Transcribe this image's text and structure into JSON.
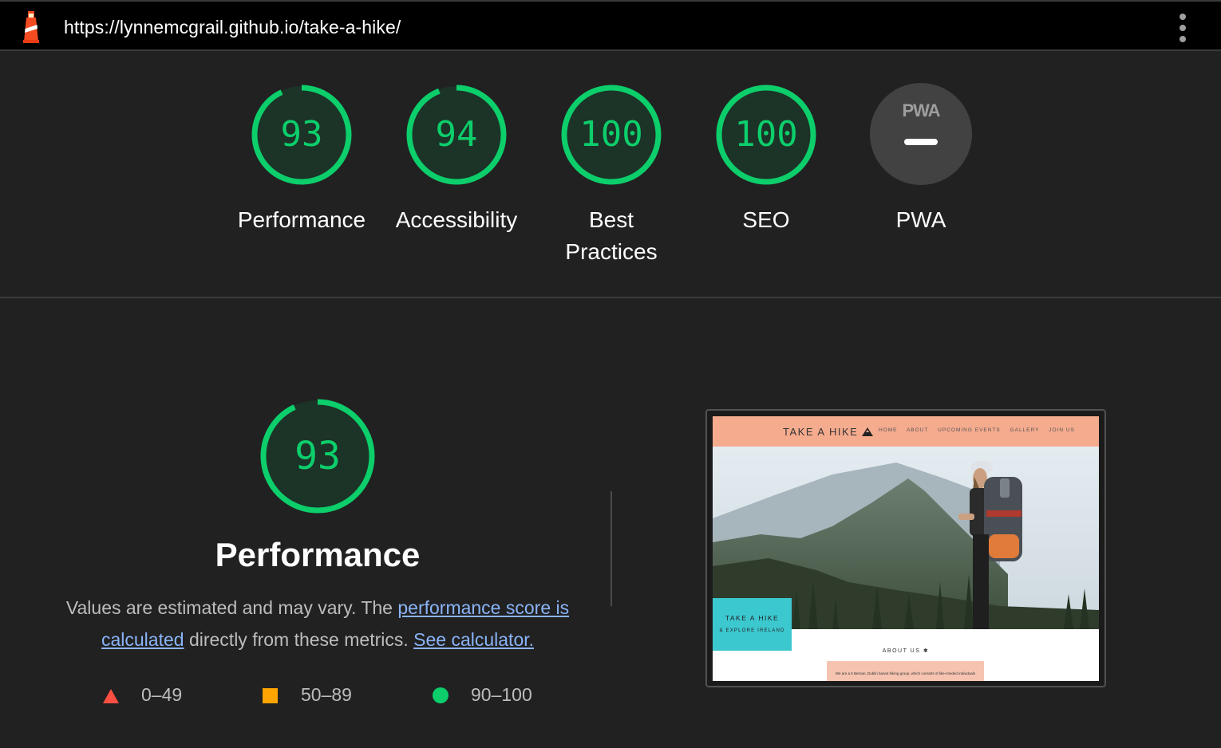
{
  "address_bar": {
    "url": "https://lynnemcgrail.github.io/take-a-hike/"
  },
  "categories": [
    {
      "id": "performance",
      "label": "Performance",
      "score": "93",
      "value": 93
    },
    {
      "id": "accessibility",
      "label": "Accessibility",
      "score": "94",
      "value": 94
    },
    {
      "id": "best-practices",
      "label": "Best Practices",
      "score": "100",
      "value": 100
    },
    {
      "id": "seo",
      "label": "SEO",
      "score": "100",
      "value": 100
    }
  ],
  "pwa": {
    "label": "PWA",
    "badge_text": "PWA"
  },
  "performance_section": {
    "score": "93",
    "value": 93,
    "title": "Performance",
    "desc_prefix": "Values are estimated and may vary. The ",
    "link1": "performance score is calculated",
    "desc_middle": " directly from these metrics. ",
    "link2": "See calculator."
  },
  "legend": [
    {
      "shape": "triangle",
      "range": "0–49",
      "color": "#ff4e42"
    },
    {
      "shape": "square",
      "range": "50–89",
      "color": "#ffa400"
    },
    {
      "shape": "circle",
      "range": "90–100",
      "color": "#0cce6b"
    }
  ],
  "screenshot": {
    "site_title": "TAKE A HIKE",
    "nav_links": [
      "HOME",
      "ABOUT",
      "UPCOMING EVENTS",
      "GALLERY",
      "JOIN US"
    ],
    "hero_title": "TAKE A HIKE",
    "hero_subtitle": "& EXPLORE IRELAND",
    "about_title": "ABOUT US",
    "about_text": "We are a 6 Bernan, Dublin based hiking group, which consists of like-minded individuals"
  },
  "colors": {
    "pass": "#0cce6b",
    "average": "#ffa400",
    "fail": "#ff4e42",
    "background": "#212121",
    "link": "#8ab4f8"
  }
}
